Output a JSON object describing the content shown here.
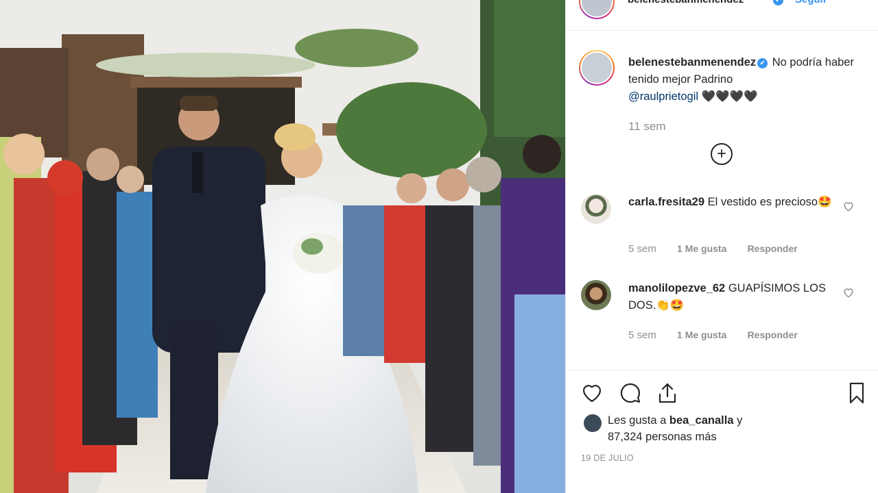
{
  "header": {
    "username": "belenestebanmenendez",
    "follow_label": "Seguir",
    "verified_icon": "✔"
  },
  "caption": {
    "username": "belenestebanmenendez",
    "verified_icon": "✔",
    "text": "No podría haber tenido mejor Padrino",
    "mention": "@raulprietogil",
    "hearts": "🖤🖤🖤🖤",
    "time": "11 sem",
    "load_more_icon": "+"
  },
  "comments": [
    {
      "username": "carla.fresita29",
      "text": "El vestido es precioso🤩",
      "time": "5 sem",
      "likes": "1 Me gusta",
      "reply": "Responder"
    },
    {
      "username": "manolilopezve_62",
      "text": "GUAPÍSIMOS LOS DOS.👏🤩",
      "time": "5 sem",
      "likes": "1 Me gusta",
      "reply": "Responder"
    }
  ],
  "likes": {
    "prefix": "Les gusta a",
    "user": "bea_canalla",
    "connector": "y",
    "count_text": "87,324 personas más"
  },
  "date": "19 DE JULIO",
  "colors": {
    "link_blue": "#3897f0",
    "mention_blue": "#003569",
    "muted": "#8e8e8e",
    "text": "#262626"
  },
  "icons": {
    "like": "heart-icon",
    "comment": "comment-bubble-icon",
    "share": "share-upload-icon",
    "save": "bookmark-icon"
  }
}
